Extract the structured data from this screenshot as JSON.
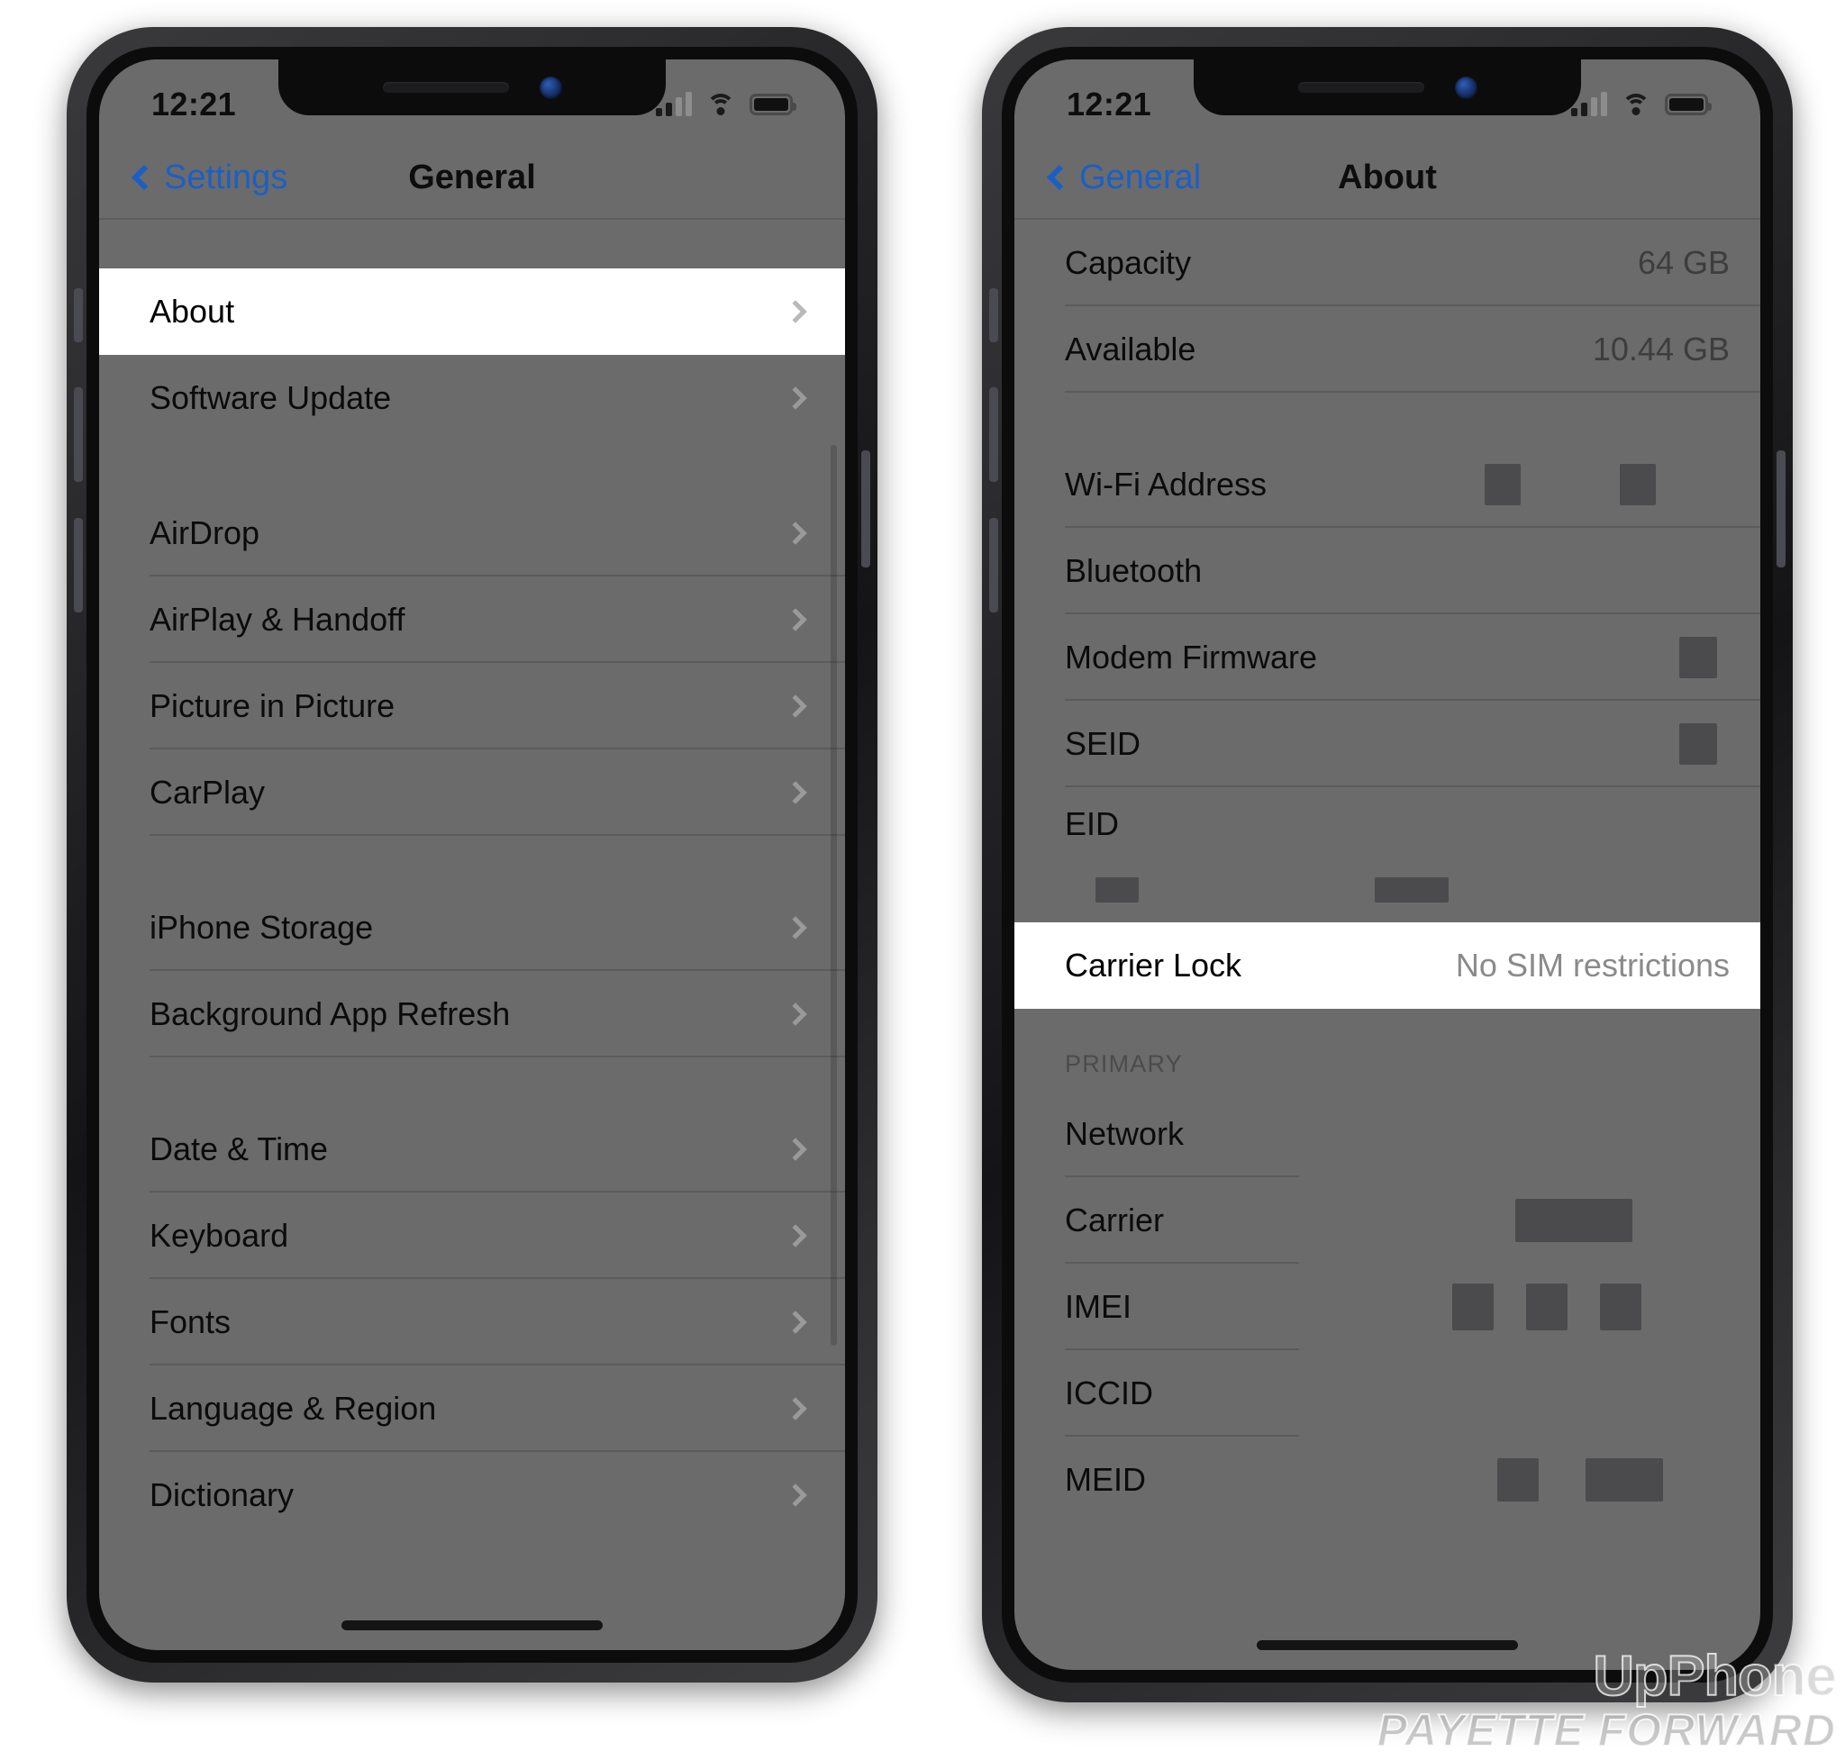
{
  "colors": {
    "accent_blue": "#1c5fc4",
    "dim_background": "#6b6b6b",
    "highlight_white": "#ffffff",
    "frame_black": "#141416",
    "redaction_block": "#4b4b4d"
  },
  "left_phone": {
    "status": {
      "time": "12:21",
      "signal_icon": "cellular-bars-icon",
      "wifi_icon": "wifi-icon",
      "battery_icon": "battery-icon"
    },
    "nav": {
      "back_label": "Settings",
      "title": "General",
      "back_icon": "chevron-left-icon"
    },
    "rows": [
      {
        "label": "About",
        "chevron": true,
        "highlight": true
      },
      {
        "label": "Software Update",
        "chevron": true
      },
      {
        "label": "AirDrop",
        "chevron": true
      },
      {
        "label": "AirPlay & Handoff",
        "chevron": true
      },
      {
        "label": "Picture in Picture",
        "chevron": true
      },
      {
        "label": "CarPlay",
        "chevron": true
      },
      {
        "label": "iPhone Storage",
        "chevron": true
      },
      {
        "label": "Background App Refresh",
        "chevron": true
      },
      {
        "label": "Date & Time",
        "chevron": true
      },
      {
        "label": "Keyboard",
        "chevron": true
      },
      {
        "label": "Fonts",
        "chevron": true
      },
      {
        "label": "Language & Region",
        "chevron": true
      },
      {
        "label": "Dictionary",
        "chevron": true
      }
    ]
  },
  "right_phone": {
    "status": {
      "time": "12:21",
      "signal_icon": "cellular-bars-icon",
      "wifi_icon": "wifi-icon",
      "battery_icon": "battery-icon"
    },
    "nav": {
      "back_label": "General",
      "title": "About",
      "back_icon": "chevron-left-icon"
    },
    "rows": [
      {
        "label": "Capacity",
        "value": "64 GB"
      },
      {
        "label": "Available",
        "value": "10.44 GB"
      },
      {
        "label": "Wi-Fi Address",
        "redacted": true
      },
      {
        "label": "Bluetooth",
        "redacted": true
      },
      {
        "label": "Modem Firmware",
        "redacted": true
      },
      {
        "label": "SEID",
        "redacted": true
      },
      {
        "label": "EID",
        "redacted": true
      },
      {
        "label": "Carrier Lock",
        "value": "No SIM restrictions",
        "highlight": true
      }
    ],
    "section_primary": {
      "header": "PRIMARY",
      "rows": [
        {
          "label": "Network"
        },
        {
          "label": "Carrier",
          "redacted": true
        },
        {
          "label": "IMEI",
          "redacted": true
        },
        {
          "label": "ICCID"
        },
        {
          "label": "MEID",
          "redacted": true
        }
      ]
    }
  },
  "watermark": {
    "line1": "UpPhone",
    "line2": "PAYETTE FORWARD"
  }
}
